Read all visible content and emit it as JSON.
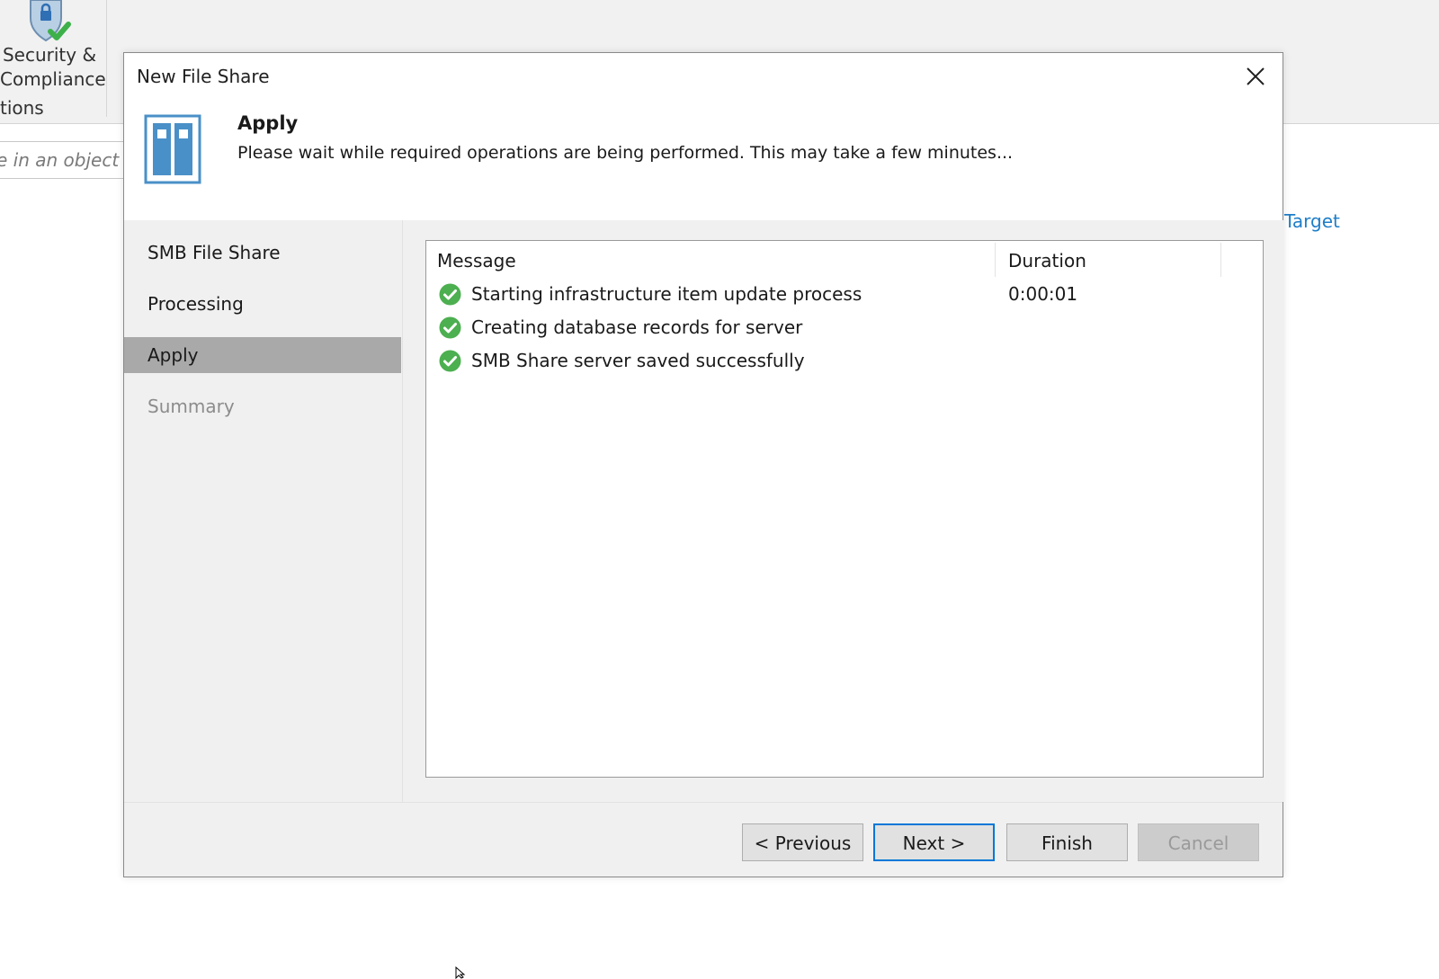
{
  "background": {
    "ribbon_button_label": "Security &\nCompliance",
    "ribbon_group_label": "tions",
    "search_placeholder": "e in an object na",
    "link_text": "Target"
  },
  "dialog": {
    "title": "New File Share",
    "heading": "Apply",
    "description": "Please wait while required operations are being performed. This may take a few minutes...",
    "steps": [
      {
        "label": "SMB File Share",
        "state": "normal"
      },
      {
        "label": "Processing",
        "state": "normal"
      },
      {
        "label": "Apply",
        "state": "active"
      },
      {
        "label": "Summary",
        "state": "disabled"
      }
    ],
    "log": {
      "columns": {
        "message": "Message",
        "duration": "Duration"
      },
      "rows": [
        {
          "status": "success",
          "message": "Starting infrastructure item update process",
          "duration": "0:00:01"
        },
        {
          "status": "success",
          "message": "Creating database records for server",
          "duration": ""
        },
        {
          "status": "success",
          "message": "SMB Share server saved successfully",
          "duration": ""
        }
      ]
    },
    "buttons": {
      "previous": "< Previous",
      "next": "Next >",
      "finish": "Finish",
      "cancel": "Cancel"
    }
  },
  "colors": {
    "success": "#4caf50",
    "accent": "#0078d7",
    "active_step": "#a9a9a9"
  }
}
